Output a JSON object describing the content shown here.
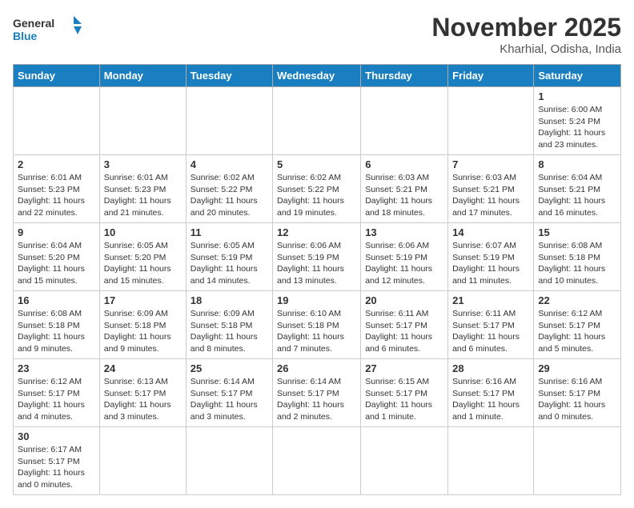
{
  "header": {
    "logo_general": "General",
    "logo_blue": "Blue",
    "month_title": "November 2025",
    "location": "Kharhial, Odisha, India"
  },
  "weekdays": [
    "Sunday",
    "Monday",
    "Tuesday",
    "Wednesday",
    "Thursday",
    "Friday",
    "Saturday"
  ],
  "days": {
    "d1": {
      "num": "1",
      "info": "Sunrise: 6:00 AM\nSunset: 5:24 PM\nDaylight: 11 hours and 23 minutes."
    },
    "d2": {
      "num": "2",
      "info": "Sunrise: 6:01 AM\nSunset: 5:23 PM\nDaylight: 11 hours and 22 minutes."
    },
    "d3": {
      "num": "3",
      "info": "Sunrise: 6:01 AM\nSunset: 5:23 PM\nDaylight: 11 hours and 21 minutes."
    },
    "d4": {
      "num": "4",
      "info": "Sunrise: 6:02 AM\nSunset: 5:22 PM\nDaylight: 11 hours and 20 minutes."
    },
    "d5": {
      "num": "5",
      "info": "Sunrise: 6:02 AM\nSunset: 5:22 PM\nDaylight: 11 hours and 19 minutes."
    },
    "d6": {
      "num": "6",
      "info": "Sunrise: 6:03 AM\nSunset: 5:21 PM\nDaylight: 11 hours and 18 minutes."
    },
    "d7": {
      "num": "7",
      "info": "Sunrise: 6:03 AM\nSunset: 5:21 PM\nDaylight: 11 hours and 17 minutes."
    },
    "d8": {
      "num": "8",
      "info": "Sunrise: 6:04 AM\nSunset: 5:21 PM\nDaylight: 11 hours and 16 minutes."
    },
    "d9": {
      "num": "9",
      "info": "Sunrise: 6:04 AM\nSunset: 5:20 PM\nDaylight: 11 hours and 15 minutes."
    },
    "d10": {
      "num": "10",
      "info": "Sunrise: 6:05 AM\nSunset: 5:20 PM\nDaylight: 11 hours and 15 minutes."
    },
    "d11": {
      "num": "11",
      "info": "Sunrise: 6:05 AM\nSunset: 5:19 PM\nDaylight: 11 hours and 14 minutes."
    },
    "d12": {
      "num": "12",
      "info": "Sunrise: 6:06 AM\nSunset: 5:19 PM\nDaylight: 11 hours and 13 minutes."
    },
    "d13": {
      "num": "13",
      "info": "Sunrise: 6:06 AM\nSunset: 5:19 PM\nDaylight: 11 hours and 12 minutes."
    },
    "d14": {
      "num": "14",
      "info": "Sunrise: 6:07 AM\nSunset: 5:19 PM\nDaylight: 11 hours and 11 minutes."
    },
    "d15": {
      "num": "15",
      "info": "Sunrise: 6:08 AM\nSunset: 5:18 PM\nDaylight: 11 hours and 10 minutes."
    },
    "d16": {
      "num": "16",
      "info": "Sunrise: 6:08 AM\nSunset: 5:18 PM\nDaylight: 11 hours and 9 minutes."
    },
    "d17": {
      "num": "17",
      "info": "Sunrise: 6:09 AM\nSunset: 5:18 PM\nDaylight: 11 hours and 9 minutes."
    },
    "d18": {
      "num": "18",
      "info": "Sunrise: 6:09 AM\nSunset: 5:18 PM\nDaylight: 11 hours and 8 minutes."
    },
    "d19": {
      "num": "19",
      "info": "Sunrise: 6:10 AM\nSunset: 5:18 PM\nDaylight: 11 hours and 7 minutes."
    },
    "d20": {
      "num": "20",
      "info": "Sunrise: 6:11 AM\nSunset: 5:17 PM\nDaylight: 11 hours and 6 minutes."
    },
    "d21": {
      "num": "21",
      "info": "Sunrise: 6:11 AM\nSunset: 5:17 PM\nDaylight: 11 hours and 6 minutes."
    },
    "d22": {
      "num": "22",
      "info": "Sunrise: 6:12 AM\nSunset: 5:17 PM\nDaylight: 11 hours and 5 minutes."
    },
    "d23": {
      "num": "23",
      "info": "Sunrise: 6:12 AM\nSunset: 5:17 PM\nDaylight: 11 hours and 4 minutes."
    },
    "d24": {
      "num": "24",
      "info": "Sunrise: 6:13 AM\nSunset: 5:17 PM\nDaylight: 11 hours and 3 minutes."
    },
    "d25": {
      "num": "25",
      "info": "Sunrise: 6:14 AM\nSunset: 5:17 PM\nDaylight: 11 hours and 3 minutes."
    },
    "d26": {
      "num": "26",
      "info": "Sunrise: 6:14 AM\nSunset: 5:17 PM\nDaylight: 11 hours and 2 minutes."
    },
    "d27": {
      "num": "27",
      "info": "Sunrise: 6:15 AM\nSunset: 5:17 PM\nDaylight: 11 hours and 1 minute."
    },
    "d28": {
      "num": "28",
      "info": "Sunrise: 6:16 AM\nSunset: 5:17 PM\nDaylight: 11 hours and 1 minute."
    },
    "d29": {
      "num": "29",
      "info": "Sunrise: 6:16 AM\nSunset: 5:17 PM\nDaylight: 11 hours and 0 minutes."
    },
    "d30": {
      "num": "30",
      "info": "Sunrise: 6:17 AM\nSunset: 5:17 PM\nDaylight: 11 hours and 0 minutes."
    }
  }
}
